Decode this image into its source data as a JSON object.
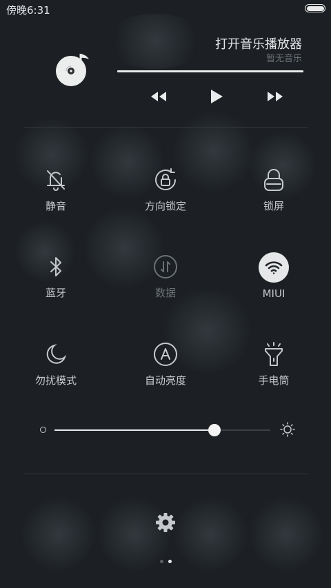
{
  "status_bar": {
    "time": "傍晚6:31"
  },
  "music": {
    "title": "打开音乐播放器",
    "subtitle": "暂无音乐",
    "icon": "music-disc-icon",
    "controls": [
      "previous-icon",
      "play-icon",
      "next-icon"
    ]
  },
  "toggles": [
    {
      "label": "静音",
      "icon": "bell-off-icon",
      "active": false
    },
    {
      "label": "方向锁定",
      "icon": "rotation-lock-icon",
      "active": false
    },
    {
      "label": "锁屏",
      "icon": "lock-icon",
      "active": false
    },
    {
      "label": "蓝牙",
      "icon": "bluetooth-icon",
      "active": false
    },
    {
      "label": "数据",
      "icon": "mobile-data-icon",
      "active": false,
      "disabled": true
    },
    {
      "label": "MIUI",
      "icon": "wifi-icon",
      "active": true
    },
    {
      "label": "勿扰模式",
      "icon": "moon-icon",
      "active": false
    },
    {
      "label": "自动亮度",
      "icon": "auto-brightness-icon",
      "active": false
    },
    {
      "label": "手电筒",
      "icon": "flashlight-icon",
      "active": false
    }
  ],
  "brightness": {
    "level": 0.74
  },
  "pager": {
    "pages": 2,
    "current": 2
  },
  "colors": {
    "background": "#1c2024",
    "active_toggle": "#e6e7e8",
    "text": "#c6c9cc",
    "muted_text": "#6c7176"
  }
}
